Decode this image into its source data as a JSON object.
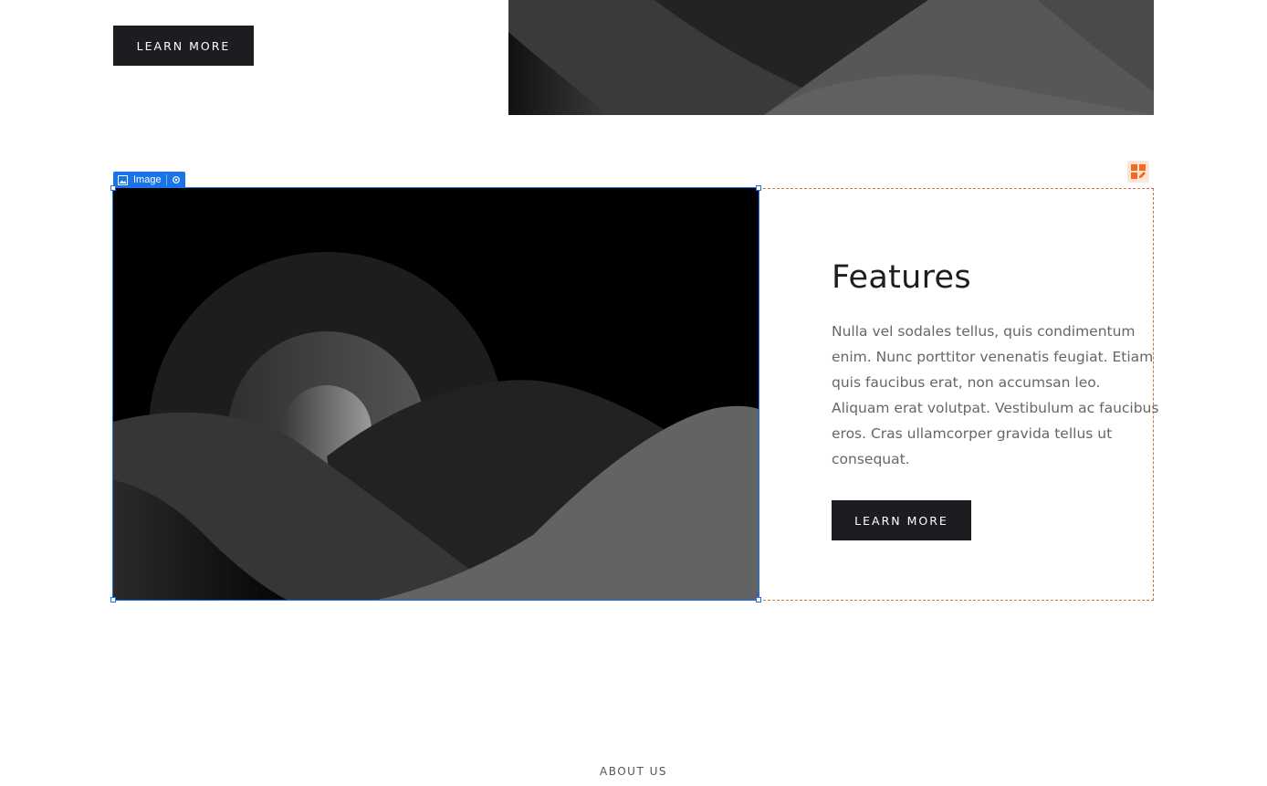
{
  "top_section": {
    "button_label": "LEARN MORE"
  },
  "editor": {
    "element_type_label": "Image",
    "toolbar_icons": [
      "image-icon",
      "gear-icon"
    ],
    "column_badge_icon": "layout-edit-icon",
    "selection_color": "#1a73e8",
    "column_outline_color": "#c5744a"
  },
  "features": {
    "title": "Features",
    "body": "Nulla vel sodales tellus, quis condimentum enim. Nunc porttitor venenatis feugiat. Etiam quis faucibus erat, non accumsan leo. Aliquam erat volutpat. Vestibulum ac faucibus eros. Cras ullamcorper gravida tellus ut consequat.",
    "button_label": "LEARN MORE"
  },
  "next_section": {
    "label": "ABOUT US"
  },
  "colors": {
    "button_bg": "#1c1d21",
    "body_text": "#666666",
    "heading_text": "#1e1e1e"
  }
}
